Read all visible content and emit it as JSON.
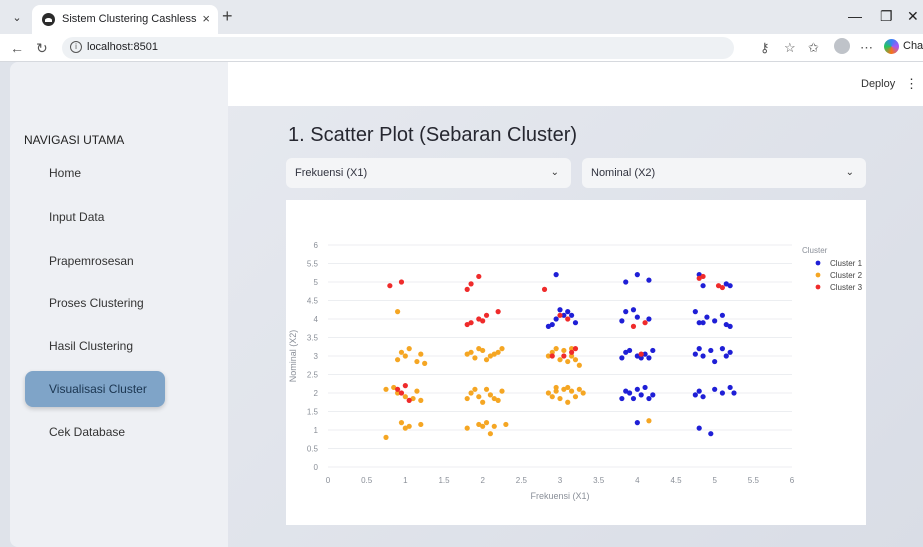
{
  "browser": {
    "tab_title": "Sistem Clustering Cashless",
    "url": "localhost:8501",
    "chat_label": "Chat"
  },
  "app": {
    "deploy_label": "Deploy",
    "menu_glyph": "⋮"
  },
  "sidebar": {
    "heading": "NAVIGASI UTAMA",
    "items": [
      {
        "label": "Home",
        "active": false
      },
      {
        "label": "Input Data",
        "active": false
      },
      {
        "label": "Prapemrosesan",
        "active": false
      },
      {
        "label": "Proses Clustering",
        "active": false
      },
      {
        "label": "Hasil Clustering",
        "active": false
      },
      {
        "label": "Visualisasi Cluster",
        "active": true
      },
      {
        "label": "Cek Database",
        "active": false
      }
    ]
  },
  "main": {
    "title": "1. Scatter Plot (Sebaran Cluster)",
    "x_select": {
      "value": "Frekuensi (X1)"
    },
    "y_select": {
      "value": "Nominal (X2)"
    }
  },
  "chart_data": {
    "type": "scatter",
    "xlabel": "Frekuensi (X1)",
    "ylabel": "Nominal (X2)",
    "xlim": [
      0,
      6
    ],
    "ylim": [
      0,
      6
    ],
    "xticks": [
      "0",
      "0.5",
      "1",
      "1.5",
      "2",
      "2.5",
      "3",
      "3.5",
      "4",
      "4.5",
      "5",
      "5.5",
      "6"
    ],
    "yticks": [
      "0",
      "0.5",
      "1",
      "1.5",
      "2",
      "2.5",
      "3",
      "3.5",
      "4",
      "4.5",
      "5",
      "5.5",
      "6"
    ],
    "grid": true,
    "legend": {
      "title": "Cluster",
      "position": "top-right"
    },
    "series": [
      {
        "name": "Cluster 1",
        "color": "#1f1fd6",
        "points": [
          [
            3.0,
            4.25
          ],
          [
            2.95,
            4.0
          ],
          [
            3.05,
            4.1
          ],
          [
            2.9,
            3.85
          ],
          [
            3.15,
            4.1
          ],
          [
            3.2,
            3.9
          ],
          [
            2.85,
            3.8
          ],
          [
            3.1,
            4.2
          ],
          [
            2.95,
            5.2
          ],
          [
            3.85,
            4.2
          ],
          [
            4.0,
            4.05
          ],
          [
            3.8,
            3.95
          ],
          [
            4.15,
            4.0
          ],
          [
            3.95,
            4.25
          ],
          [
            4.0,
            5.2
          ],
          [
            3.85,
            5.0
          ],
          [
            4.15,
            5.05
          ],
          [
            3.85,
            3.1
          ],
          [
            4.0,
            3.0
          ],
          [
            4.1,
            3.05
          ],
          [
            4.2,
            3.15
          ],
          [
            3.9,
            3.15
          ],
          [
            4.05,
            2.95
          ],
          [
            4.15,
            2.95
          ],
          [
            3.8,
            2.95
          ],
          [
            3.85,
            2.05
          ],
          [
            4.0,
            2.1
          ],
          [
            3.8,
            1.85
          ],
          [
            4.1,
            2.15
          ],
          [
            4.2,
            1.95
          ],
          [
            3.95,
            1.85
          ],
          [
            4.05,
            1.95
          ],
          [
            4.15,
            1.85
          ],
          [
            3.9,
            2.0
          ],
          [
            4.0,
            1.2
          ],
          [
            4.8,
            5.2
          ],
          [
            4.85,
            4.9
          ],
          [
            5.15,
            4.95
          ],
          [
            5.2,
            4.9
          ],
          [
            4.75,
            4.2
          ],
          [
            4.9,
            4.05
          ],
          [
            5.0,
            3.95
          ],
          [
            5.1,
            4.1
          ],
          [
            4.85,
            3.9
          ],
          [
            5.15,
            3.85
          ],
          [
            5.2,
            3.8
          ],
          [
            4.8,
            3.9
          ],
          [
            4.8,
            3.2
          ],
          [
            4.95,
            3.15
          ],
          [
            5.1,
            3.2
          ],
          [
            5.2,
            3.1
          ],
          [
            4.85,
            3.0
          ],
          [
            5.0,
            2.85
          ],
          [
            4.75,
            3.05
          ],
          [
            5.15,
            3.0
          ],
          [
            4.8,
            2.05
          ],
          [
            5.0,
            2.1
          ],
          [
            5.1,
            2.0
          ],
          [
            5.2,
            2.15
          ],
          [
            4.85,
            1.9
          ],
          [
            5.25,
            2.0
          ],
          [
            4.75,
            1.95
          ],
          [
            4.8,
            1.05
          ],
          [
            4.95,
            0.9
          ]
        ]
      },
      {
        "name": "Cluster 2",
        "color": "#f5a623",
        "points": [
          [
            0.9,
            4.2
          ],
          [
            0.95,
            3.1
          ],
          [
            1.05,
            3.2
          ],
          [
            1.2,
            3.05
          ],
          [
            0.9,
            2.9
          ],
          [
            1.0,
            3.0
          ],
          [
            1.15,
            2.85
          ],
          [
            1.25,
            2.8
          ],
          [
            0.75,
            2.1
          ],
          [
            0.9,
            2.0
          ],
          [
            1.0,
            1.9
          ],
          [
            1.15,
            2.05
          ],
          [
            0.85,
            2.15
          ],
          [
            1.1,
            1.85
          ],
          [
            1.2,
            1.8
          ],
          [
            0.95,
            1.2
          ],
          [
            1.05,
            1.1
          ],
          [
            1.2,
            1.15
          ],
          [
            1.0,
            1.05
          ],
          [
            0.75,
            0.8
          ],
          [
            1.85,
            3.1
          ],
          [
            2.0,
            3.15
          ],
          [
            2.1,
            3.0
          ],
          [
            2.2,
            3.1
          ],
          [
            1.9,
            2.95
          ],
          [
            2.05,
            2.9
          ],
          [
            2.15,
            3.05
          ],
          [
            1.95,
            3.2
          ],
          [
            2.25,
            3.2
          ],
          [
            1.8,
            3.05
          ],
          [
            1.85,
            2.0
          ],
          [
            1.95,
            1.9
          ],
          [
            2.05,
            2.1
          ],
          [
            2.15,
            1.85
          ],
          [
            1.8,
            1.85
          ],
          [
            2.0,
            1.75
          ],
          [
            2.1,
            1.95
          ],
          [
            2.2,
            1.8
          ],
          [
            2.25,
            2.05
          ],
          [
            1.9,
            2.1
          ],
          [
            1.95,
            1.15
          ],
          [
            2.05,
            1.2
          ],
          [
            2.15,
            1.1
          ],
          [
            1.8,
            1.05
          ],
          [
            2.0,
            1.1
          ],
          [
            2.3,
            1.15
          ],
          [
            2.1,
            0.9
          ],
          [
            2.9,
            3.1
          ],
          [
            3.05,
            3.15
          ],
          [
            3.15,
            3.0
          ],
          [
            3.2,
            2.9
          ],
          [
            2.85,
            3.0
          ],
          [
            3.0,
            2.9
          ],
          [
            3.1,
            2.85
          ],
          [
            3.25,
            2.75
          ],
          [
            2.95,
            3.2
          ],
          [
            3.15,
            3.2
          ],
          [
            2.85,
            2.0
          ],
          [
            2.95,
            2.15
          ],
          [
            3.05,
            2.1
          ],
          [
            3.15,
            2.05
          ],
          [
            3.25,
            2.1
          ],
          [
            2.9,
            1.9
          ],
          [
            3.0,
            1.85
          ],
          [
            3.1,
            2.15
          ],
          [
            3.2,
            1.9
          ],
          [
            3.3,
            2.0
          ],
          [
            2.95,
            2.05
          ],
          [
            3.1,
            1.75
          ],
          [
            4.15,
            1.25
          ]
        ]
      },
      {
        "name": "Cluster 3",
        "color": "#ef2b2b",
        "points": [
          [
            0.8,
            4.9
          ],
          [
            0.95,
            5.0
          ],
          [
            0.9,
            2.1
          ],
          [
            1.0,
            2.2
          ],
          [
            1.05,
            1.8
          ],
          [
            0.95,
            2.0
          ],
          [
            1.8,
            4.8
          ],
          [
            1.85,
            4.95
          ],
          [
            1.95,
            5.15
          ],
          [
            1.8,
            3.85
          ],
          [
            1.85,
            3.9
          ],
          [
            1.95,
            4.0
          ],
          [
            2.05,
            4.1
          ],
          [
            2.2,
            4.2
          ],
          [
            2.0,
            3.95
          ],
          [
            2.8,
            4.8
          ],
          [
            3.0,
            4.1
          ],
          [
            3.1,
            4.0
          ],
          [
            3.05,
            3.0
          ],
          [
            3.15,
            3.1
          ],
          [
            3.2,
            3.2
          ],
          [
            2.9,
            3.0
          ],
          [
            3.95,
            3.8
          ],
          [
            4.05,
            3.05
          ],
          [
            4.1,
            3.9
          ],
          [
            4.85,
            5.15
          ],
          [
            5.1,
            4.85
          ],
          [
            5.05,
            4.9
          ],
          [
            4.8,
            5.1
          ]
        ]
      }
    ]
  }
}
